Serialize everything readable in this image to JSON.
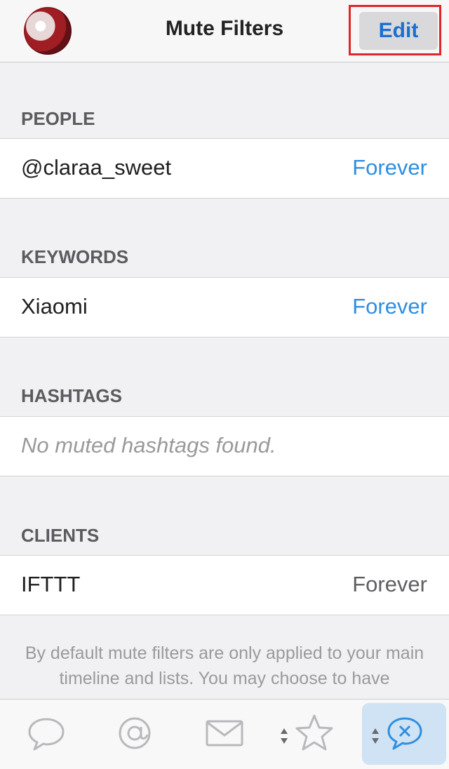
{
  "nav": {
    "title": "Mute Filters",
    "edit_label": "Edit"
  },
  "sections": {
    "people": {
      "title": "PEOPLE",
      "rows": [
        {
          "label": "@claraa_sweet",
          "value": "Forever"
        }
      ]
    },
    "keywords": {
      "title": "KEYWORDS",
      "rows": [
        {
          "label": "Xiaomi",
          "value": "Forever"
        }
      ]
    },
    "hashtags": {
      "title": "HASHTAGS",
      "empty": "No muted hashtags found."
    },
    "clients": {
      "title": "CLIENTS",
      "rows": [
        {
          "label": "IFTTT",
          "value": "Forever"
        }
      ]
    }
  },
  "footer": {
    "text": "By default mute filters are only applied to your main timeline and lists. You may choose to have"
  },
  "tabbar": {
    "icons": [
      "speech-bubble-icon",
      "at-icon",
      "envelope-icon",
      "star-icon",
      "muted-bubble-icon"
    ],
    "accent": "#2f8fe0"
  },
  "colors": {
    "accent": "#1a6fd0",
    "highlight_box": "#e2242b",
    "active_tab_bg": "#cfe3f5"
  }
}
